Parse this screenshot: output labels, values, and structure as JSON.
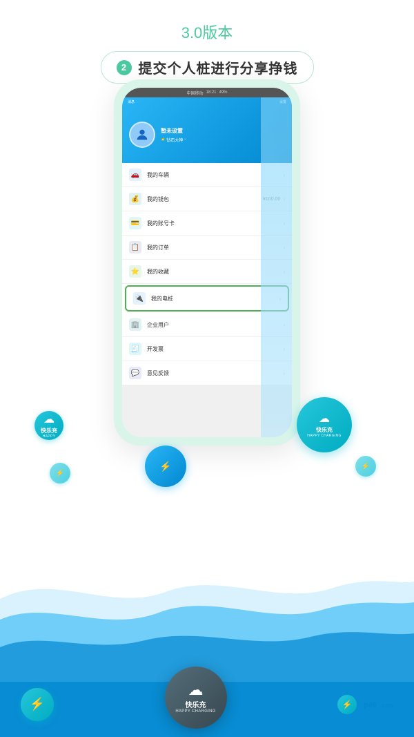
{
  "page": {
    "background_color": "#ffffff"
  },
  "header": {
    "version_text": "3.0版本",
    "subtitle_number": "2",
    "subtitle_label": "提交个人桩进行分享挣钱"
  },
  "phone": {
    "status_bar": {
      "carrier": "中国移动",
      "time": "18:21",
      "right": "49%"
    },
    "nav": {
      "messages": "消息",
      "settings": "设置"
    },
    "profile": {
      "name": "暂未设置",
      "badge": "钻石大神"
    },
    "menu_items": [
      {
        "label": "我的车辆",
        "value": "",
        "icon_type": "blue"
      },
      {
        "label": "我的钱包",
        "value": "¥100.00",
        "icon_type": "teal"
      },
      {
        "label": "我的账号卡",
        "value": "",
        "icon_type": "cyan"
      },
      {
        "label": "我的订单",
        "value": "",
        "icon_type": "indigo"
      },
      {
        "label": "我的收藏",
        "value": "",
        "icon_type": "green"
      },
      {
        "label": "我的电桩",
        "value": "",
        "icon_type": "blue",
        "highlighted": true
      },
      {
        "label": "企业用户",
        "value": "",
        "icon_type": "teal"
      },
      {
        "label": "开发票",
        "value": "",
        "icon_type": "cyan"
      },
      {
        "label": "意见反馈",
        "value": "",
        "icon_type": "indigo"
      }
    ]
  },
  "bubbles": {
    "happy_charging_label": "快乐充",
    "happy_charging_sub": "HAPPY CHARGING",
    "lightning_symbol": "⚡"
  },
  "bottom": {
    "center_logo_main": "快乐充",
    "center_logo_sub": "HAPPY CHARGING",
    "pca6_text": "pé6.com"
  }
}
